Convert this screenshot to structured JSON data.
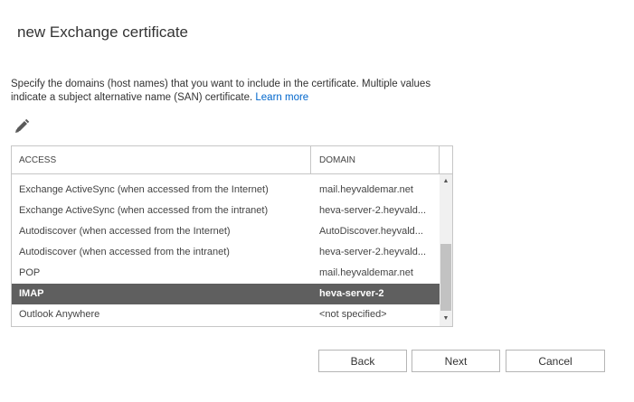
{
  "dialog": {
    "title": "new Exchange certificate",
    "description": "Specify the domains (host names) that you want to include in the certificate. Multiple values indicate a subject alternative name (SAN) certificate.",
    "learn_more": "Learn more"
  },
  "toolbar": {
    "edit_icon": "pencil-icon"
  },
  "grid": {
    "columns": {
      "access": "ACCESS",
      "domain": "DOMAIN"
    },
    "rows": [
      {
        "access": "Exchange ActiveSync (when accessed from the Internet)",
        "domain": "mail.heyvaldemar.net"
      },
      {
        "access": "Exchange ActiveSync (when accessed from the intranet)",
        "domain": "heva-server-2.heyvald..."
      },
      {
        "access": "Autodiscover (when accessed from the Internet)",
        "domain": "AutoDiscover.heyvald..."
      },
      {
        "access": "Autodiscover (when accessed from the intranet)",
        "domain": "heva-server-2.heyvald..."
      },
      {
        "access": "POP",
        "domain": "mail.heyvaldemar.net"
      },
      {
        "access": "IMAP",
        "domain": "heva-server-2"
      },
      {
        "access": "Outlook Anywhere",
        "domain": "<not specified>"
      }
    ],
    "selected_row": "IMAP"
  },
  "buttons": {
    "back": "Back",
    "next": "Next",
    "cancel": "Cancel"
  },
  "colors": {
    "link": "#0066cc",
    "selected_row": "#5f5f5f",
    "border": "#c6c6c6"
  }
}
